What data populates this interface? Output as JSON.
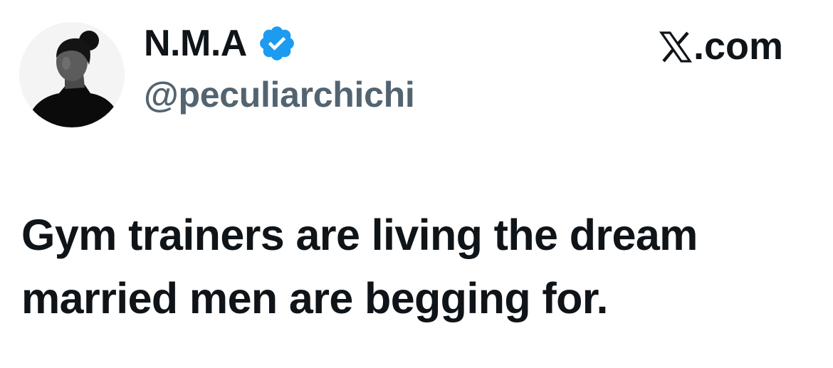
{
  "author": {
    "display_name": "N.M.A",
    "handle": "@peculiarchichi",
    "verified": true,
    "avatar": "profile-photo"
  },
  "brand": {
    "label": ".com",
    "logo_icon": "x-logo-icon"
  },
  "tweet": {
    "text": "Gym trainers are living the dream married men are begging for."
  },
  "colors": {
    "text_primary": "#0f1419",
    "text_secondary": "#536471",
    "verified_blue": "#1d9bf0",
    "background": "#ffffff"
  }
}
